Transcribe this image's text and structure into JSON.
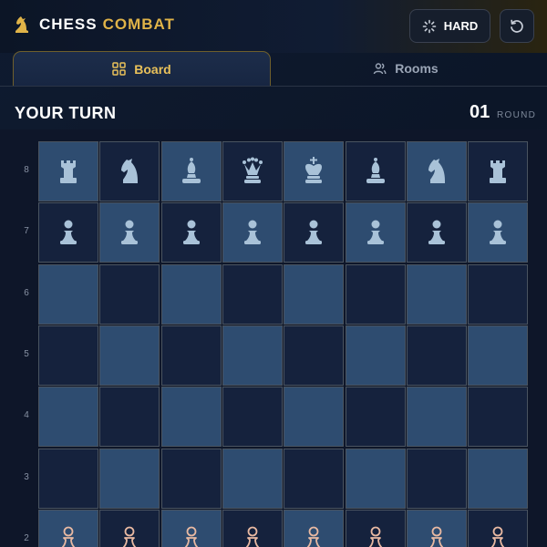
{
  "header": {
    "brand_main": "CHESS",
    "brand_accent": "COMBAT",
    "difficulty_label": "HARD"
  },
  "tabs": [
    {
      "label": "Board",
      "active": true
    },
    {
      "label": "Rooms",
      "active": false
    }
  ],
  "status": {
    "turn_text": "YOUR TURN",
    "round_number": "01",
    "round_label": "ROUND"
  },
  "board": {
    "visible_ranks": [
      "8",
      "7",
      "6",
      "5",
      "4",
      "3",
      "2"
    ],
    "rank_8": [
      "rook",
      "knight",
      "bishop",
      "queen",
      "king",
      "bishop",
      "knight",
      "rook"
    ],
    "rank_7": [
      "pawn",
      "pawn",
      "pawn",
      "pawn",
      "pawn",
      "pawn",
      "pawn",
      "pawn"
    ],
    "rank_2": [
      "pawn",
      "pawn",
      "pawn",
      "pawn",
      "pawn",
      "pawn",
      "pawn",
      "pawn"
    ],
    "opponent_piece_color": "#a9c2d8",
    "player_piece_color": "#e8b9a2",
    "light_square_color": "#2e4c70",
    "dark_square_color": "#15223d"
  },
  "colors": {
    "accent": "#e0b348",
    "tab_active_text": "#e9c15a",
    "background": "#0f1a2e"
  }
}
